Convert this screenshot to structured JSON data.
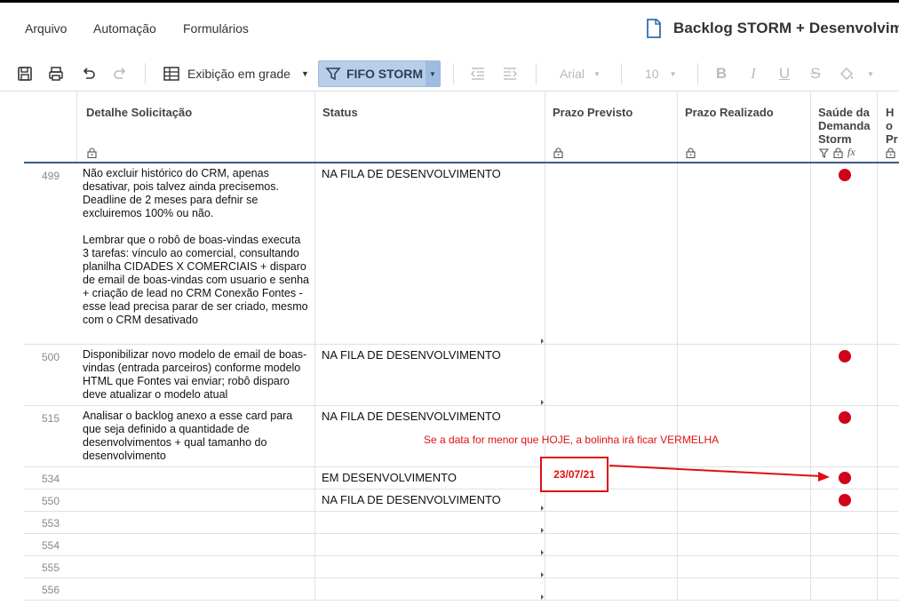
{
  "menu": {
    "file": "Arquivo",
    "automation": "Automação",
    "forms": "Formulários"
  },
  "doc_title": "Backlog STORM + Desenvolvimento",
  "toolbar": {
    "view_label": "Exibição em grade",
    "filter_label": "FIFO STORM",
    "font_family": "Arial",
    "font_size": "10"
  },
  "columns": {
    "detalhe": "Detalhe Solicitação",
    "status": "Status",
    "prazo_previsto": "Prazo Previsto",
    "prazo_realizado": "Prazo Realizado",
    "saude": "Saúde da Demanda Storm",
    "hora": "Ho Pr"
  },
  "rows": [
    {
      "id": "499",
      "detalhe": "Não excluir histórico do CRM, apenas desativar, pois talvez ainda precisemos. Deadline de 2 meses para defnir se excluiremos 100% ou não.\n\nLembrar que o robô de boas-vindas executa 3 tarefas: vínculo ao comercial, consultando planilha CIDADES X COMERCIAIS + disparo de email de boas-vindas com usuario e senha + criação de lead no CRM Conexão Fontes - esse lead precisa parar de ser criado, mesmo com o CRM desativado",
      "status": "NA FILA DE DESENVOLVIMENTO",
      "saude": "red"
    },
    {
      "id": "500",
      "detalhe": "Disponibilizar novo modelo de email de boas-vindas (entrada parceiros) conforme modelo HTML que Fontes vai enviar; robô disparo deve atualizar o modelo atual",
      "status": "NA FILA DE DESENVOLVIMENTO",
      "saude": "red"
    },
    {
      "id": "515",
      "detalhe": "Analisar o backlog anexo a esse card para que seja definido a quantidade de desenvolvimentos + qual tamanho do desenvolvimento",
      "status": "NA FILA DE DESENVOLVIMENTO",
      "saude": "red"
    },
    {
      "id": "534",
      "detalhe": "",
      "status": "EM DESENVOLVIMENTO",
      "prazo_previsto": "23/07/21",
      "saude": "red"
    },
    {
      "id": "550",
      "detalhe": "",
      "status": "NA FILA DE DESENVOLVIMENTO",
      "saude": "red"
    },
    {
      "id": "553",
      "detalhe": "",
      "status": ""
    },
    {
      "id": "554",
      "detalhe": "",
      "status": ""
    },
    {
      "id": "555",
      "detalhe": "",
      "status": ""
    },
    {
      "id": "556",
      "detalhe": "",
      "status": ""
    }
  ],
  "annotation": "Se a data for menor que HOJE, a bolinha irá ficar VERMELHA",
  "colors": {
    "accent": "#b8cfe8",
    "status_red": "#d0021b",
    "annotation": "#e01010",
    "header_line": "#3d5a8a"
  }
}
